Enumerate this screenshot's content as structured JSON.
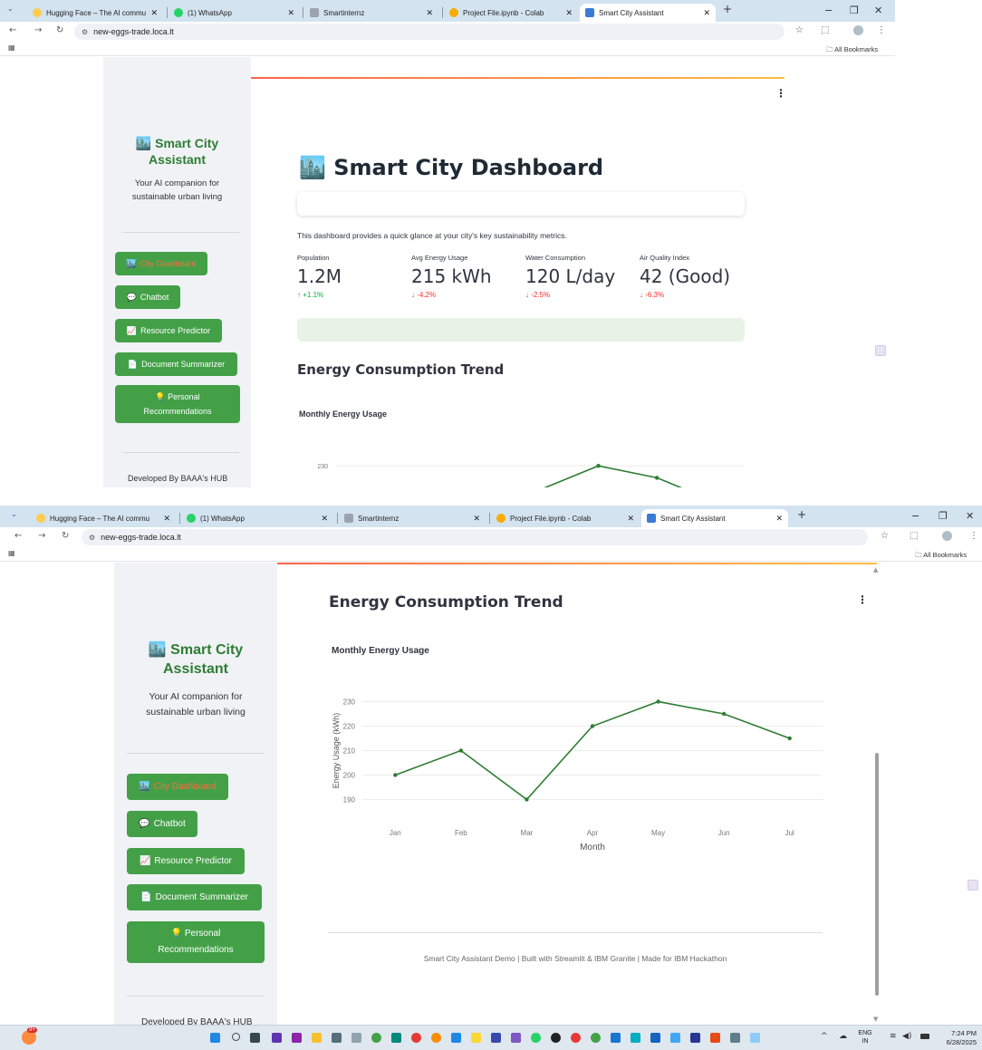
{
  "browser": {
    "tabs": [
      {
        "title": "Hugging Face – The AI commu",
        "active": false
      },
      {
        "title": "(1) WhatsApp",
        "active": false
      },
      {
        "title": "Smartinternz",
        "active": false
      },
      {
        "title": "Project File.ipynb - Colab",
        "active": false
      },
      {
        "title": "Smart City Assistant",
        "active": true
      }
    ],
    "new_tab": "+",
    "url": "new-eggs-trade.loca.lt",
    "all_bookmarks": "All Bookmarks",
    "whatsapp_badge": "1"
  },
  "sidebar": {
    "emoji": "🏙️",
    "title_line1": "Smart City",
    "title_line2": "Assistant",
    "tagline_line1": "Your AI companion for",
    "tagline_line2": "sustainable urban living",
    "nav": [
      {
        "icon": "🏙️",
        "label": "City Dashboard",
        "current": true
      },
      {
        "icon": "💬",
        "label": "Chatbot",
        "current": false
      },
      {
        "icon": "📈",
        "label": "Resource Predictor",
        "current": false
      },
      {
        "icon": "📄",
        "label": "Document Summarizer",
        "current": false
      },
      {
        "icon": "💡",
        "label_line1": "Personal",
        "label_line2": "Recommendations",
        "current": false
      }
    ],
    "footer": "Developed By BAAA's HUB"
  },
  "main": {
    "menu_icon": "⋮",
    "title_emoji": "🏙️",
    "title": "Smart City Dashboard",
    "intro": "This dashboard provides a quick glance at your city's key sustainability metrics.",
    "metrics": [
      {
        "label": "Population",
        "value": "1.2M",
        "delta": "↑ +1.1%",
        "direction": "up"
      },
      {
        "label": "Avg Energy Usage",
        "value": "215 kWh",
        "delta": "↓ -4.2%",
        "direction": "down"
      },
      {
        "label": "Water Consumption",
        "value": "120 L/day",
        "delta": "↓ -2.5%",
        "direction": "down"
      },
      {
        "label": "Air Quality Index",
        "value": "42 (Good)",
        "delta": "↓ -6.3%",
        "direction": "down"
      }
    ],
    "section_title": "Energy Consumption Trend",
    "chart_title": "Monthly Energy Usage",
    "footer": "Smart City Assistant Demo | Built with Streamlit & IBM Granite | Made for IBM Hackathon"
  },
  "chart_data": {
    "type": "line",
    "title": "Monthly Energy Usage",
    "x": [
      "Jan",
      "Feb",
      "Mar",
      "Apr",
      "May",
      "Jun",
      "Jul"
    ],
    "values": [
      200,
      210,
      190,
      220,
      230,
      225,
      215
    ],
    "xlabel": "Month",
    "ylabel": "Energy Usage (kWh)",
    "yticks": [
      190,
      200,
      210,
      220,
      230
    ],
    "ylim": [
      185,
      235
    ],
    "grid": true,
    "color": "#2e7d32"
  },
  "taskbar": {
    "weather_badge": "9+",
    "lang_line1": "ENG",
    "lang_line2": "IN",
    "time": "7:24 PM",
    "date": "6/28/2025"
  },
  "colors": {
    "sidebar_bg": "#f0f2f6",
    "nav_button": "#43a047",
    "current_label": "#ff6b3d",
    "title_green": "#2e7d32",
    "delta_down": "#ff2b2b",
    "delta_up": "#09ab3b",
    "info_bar": "#e8f3e6"
  }
}
